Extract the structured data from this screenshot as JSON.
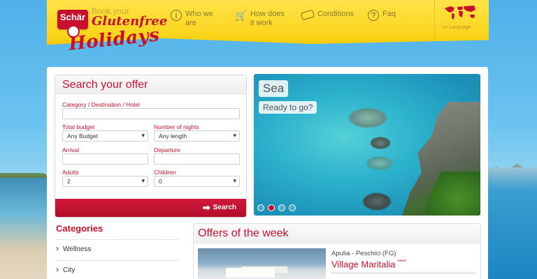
{
  "header": {
    "logo_text": "Schär",
    "brand_small": "Book your",
    "brand_line1": "Glutenfree",
    "brand_line2": "Holidays",
    "nav": [
      {
        "icon": "info-icon",
        "label": "Who we are"
      },
      {
        "icon": "cart-icon",
        "label": "How does it work"
      },
      {
        "icon": "tag-icon",
        "label": "Conditions"
      },
      {
        "icon": "question-icon",
        "label": "Faq"
      }
    ],
    "language_link": ">> Language",
    "accent_color": "#c8102e"
  },
  "search": {
    "title": "Search your offer",
    "category_label": "Category / Destination / Hotel",
    "category_value": "",
    "budget_label": "Total budget",
    "budget_value": "Any Budget",
    "nights_label": "Number of nights",
    "nights_value": "Any length",
    "arrival_label": "Arrival",
    "arrival_value": "",
    "departure_label": "Departure",
    "departure_value": "",
    "adults_label": "Adults",
    "adults_value": "2",
    "children_label": "Children",
    "children_value": "0",
    "button_label": "Search"
  },
  "hero": {
    "title": "Sea",
    "subtitle": "Ready to go?",
    "slides_total": 4,
    "active_slide": 2
  },
  "categories": {
    "title": "Categories",
    "items": [
      "Wellness",
      "City"
    ]
  },
  "offers": {
    "title": "Offers of the week",
    "items": [
      {
        "location": "Apulia - Peschici (FG)",
        "name": "Village Maritalia",
        "stars": "****"
      }
    ]
  }
}
